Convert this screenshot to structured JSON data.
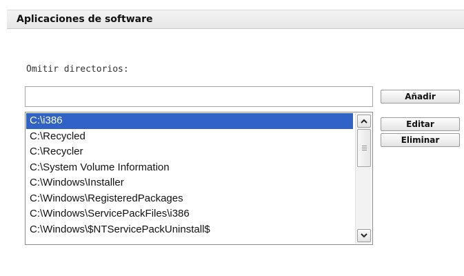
{
  "panel": {
    "title": "Aplicaciones de software"
  },
  "omit_directories": {
    "label": "Omitir directorios:",
    "input_value": "",
    "items": [
      {
        "label": "C:\\i386",
        "selected": true
      },
      {
        "label": "C:\\Recycled",
        "selected": false
      },
      {
        "label": "C:\\Recycler",
        "selected": false
      },
      {
        "label": "C:\\System Volume Information",
        "selected": false
      },
      {
        "label": "C:\\Windows\\Installer",
        "selected": false
      },
      {
        "label": "C:\\Windows\\RegisteredPackages",
        "selected": false
      },
      {
        "label": "C:\\Windows\\ServicePackFiles\\i386",
        "selected": false
      },
      {
        "label": "C:\\Windows\\$NTServicePackUninstall$",
        "selected": false
      }
    ]
  },
  "buttons": {
    "add": "Añadir",
    "edit": "Editar",
    "delete": "Eliminar"
  },
  "colors": {
    "selection": "#3162c6",
    "header_bg": "#e9e9e9"
  },
  "icons": {
    "scroll_up": "chevron-up-icon",
    "scroll_down": "chevron-down-icon"
  }
}
